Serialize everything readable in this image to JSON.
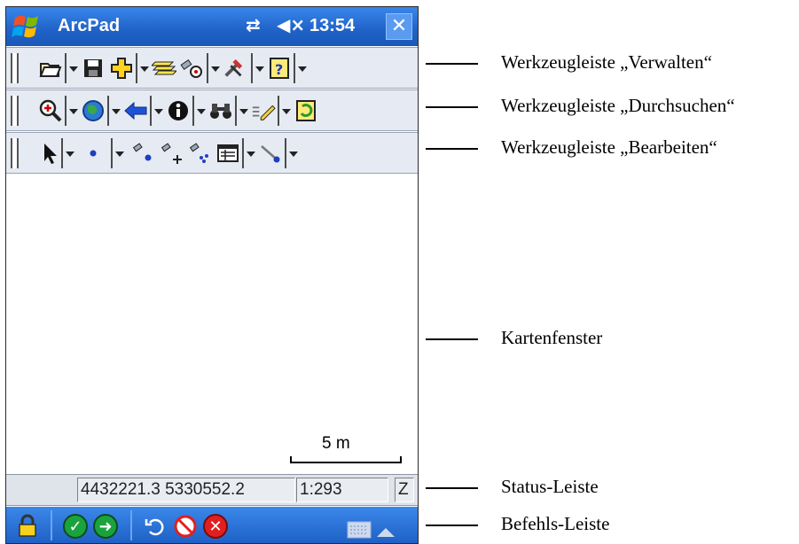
{
  "app": {
    "title": "ArcPad",
    "clock": "13:54",
    "sync_icon": "⇄",
    "volume_icon": "◀×",
    "close_icon": "✕"
  },
  "map": {
    "scale_bar_label": "5 m"
  },
  "status_bar": {
    "coordinates": "4432221.3 5330552.2",
    "scale": "1:293",
    "z": "Z"
  },
  "callouts": {
    "verwalten": "Werkzeugleiste „Verwalten“",
    "durchsuchen": "Werkzeugleiste „Durchsuchen“",
    "bearbeiten": "Werkzeugleiste „Bearbeiten“",
    "kartenfenster": "Kartenfenster",
    "status": "Status-Leiste",
    "befehls": "Befehls-Leiste"
  },
  "colors": {
    "title_bar": "#1f62c8",
    "toolbar_bg": "#e6eaf2",
    "ok_green": "#1aa33c",
    "cancel_red": "#e02020"
  },
  "icons": {
    "manage_toolbar": [
      "open-folder-icon",
      "save-icon",
      "add-layer-icon",
      "layers-icon",
      "gps-icon",
      "tools-icon",
      "help-icon"
    ],
    "browse_toolbar": [
      "zoom-in-icon",
      "globe-icon",
      "back-arrow-icon",
      "identify-icon",
      "find-binoculars-icon",
      "pen-icon",
      "refresh-icon"
    ],
    "edit_toolbar": [
      "select-arrow-icon",
      "point-icon",
      "add-vertex-icon",
      "add-gps-vertex-icon",
      "gps-average-icon",
      "attribute-table-icon",
      "line-edit-icon"
    ],
    "command_bar": [
      "lock-icon",
      "ok-icon",
      "next-icon",
      "undo-icon",
      "no-gps-icon",
      "cancel-icon",
      "keyboard-icon"
    ]
  }
}
